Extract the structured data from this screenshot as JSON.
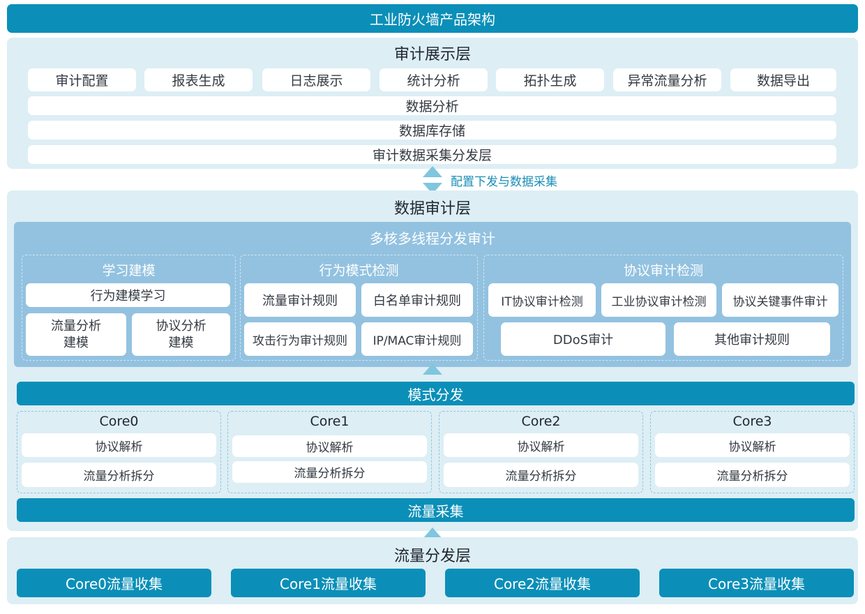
{
  "header": {
    "title": "工业防火墙产品架构"
  },
  "audit_display": {
    "title": "审计展示层",
    "items": [
      "审计配置",
      "报表生成",
      "日志展示",
      "统计分析",
      "拓扑生成",
      "异常流量分析",
      "数据导出"
    ],
    "bars": [
      "数据分析",
      "数据库存储",
      "审计数据采集分发层"
    ]
  },
  "connector": {
    "label": "配置下发与数据采集"
  },
  "data_audit": {
    "title": "数据审计层",
    "multicore": {
      "title": "多核多线程分发审计",
      "learning": {
        "title": "学习建模",
        "top": "行为建模学习",
        "left": "流量分析\n建模",
        "right": "协议分析\n建模"
      },
      "behavior": {
        "title": "行为模式检测",
        "items": [
          "流量审计规则",
          "白名单审计规则",
          "攻击行为审计规则",
          "IP/MAC审计规则"
        ]
      },
      "protocol": {
        "title": "协议审计检测",
        "row1": [
          "IT协议审计检测",
          "工业协议审计检测",
          "协议关键事件审计"
        ],
        "row2": [
          "DDoS审计",
          "其他审计规则"
        ]
      }
    },
    "mode_dispatch": "模式分发",
    "cores": [
      {
        "name": "Core0",
        "a": "协议解析",
        "b": "流量分析拆分"
      },
      {
        "name": "Core1",
        "a": "协议解析",
        "b": "流量分析拆分"
      },
      {
        "name": "Core2",
        "a": "协议解析",
        "b": "流量分析拆分"
      },
      {
        "name": "Core3",
        "a": "协议解析",
        "b": "流量分析拆分"
      }
    ],
    "traffic_collect": "流量采集"
  },
  "dispatch_layer": {
    "title": "流量分发层",
    "items": [
      "Core0流量收集",
      "Core1流量收集",
      "Core2流量收集",
      "Core3流量收集"
    ]
  }
}
